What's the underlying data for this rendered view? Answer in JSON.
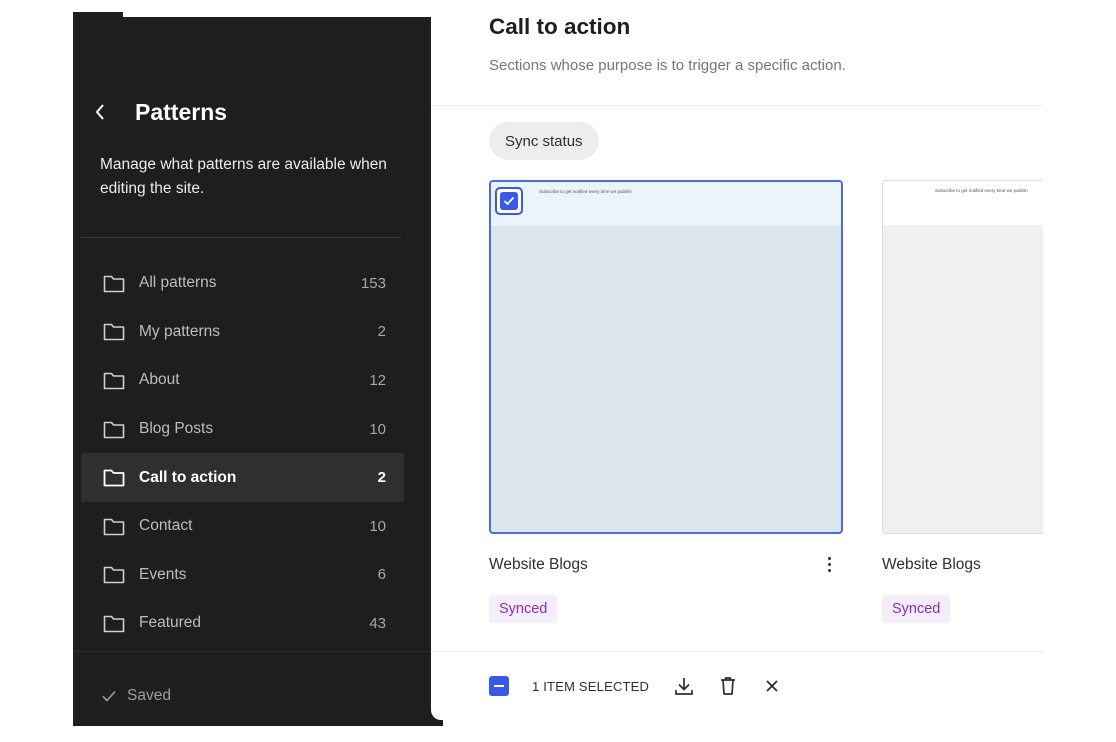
{
  "sidebar": {
    "title": "Patterns",
    "description": "Manage what patterns are available when editing the site.",
    "items": [
      {
        "label": "All patterns",
        "count": "153"
      },
      {
        "label": "My patterns",
        "count": "2"
      },
      {
        "label": "About",
        "count": "12"
      },
      {
        "label": "Blog Posts",
        "count": "10"
      },
      {
        "label": "Call to action",
        "count": "2",
        "active": true
      },
      {
        "label": "Contact",
        "count": "10"
      },
      {
        "label": "Events",
        "count": "6"
      },
      {
        "label": "Featured",
        "count": "43"
      }
    ],
    "status": "Saved"
  },
  "main": {
    "title": "Call to action",
    "description": "Sections whose purpose is to trigger a specific action.",
    "filter_label": "Sync status",
    "cards": [
      {
        "title": "Website Blogs",
        "badge": "Synced",
        "selected": true,
        "preview_text": "Subscribe to get notified every time we publish"
      },
      {
        "title": "Website Blogs",
        "badge": "Synced",
        "selected": false,
        "preview_text": "Subscribe to get notified every time we publish"
      }
    ]
  },
  "bulk": {
    "selected_label": "1 ITEM SELECTED"
  },
  "colors": {
    "sidebar_bg": "#1e1e1e",
    "accent": "#3858e9",
    "badge_text": "#8a2bbf",
    "badge_bg": "#f4eef9"
  },
  "icons": [
    "chevron-left-icon",
    "folder-icon",
    "check-icon",
    "kebab-menu-icon",
    "download-icon",
    "trash-icon",
    "close-icon"
  ]
}
